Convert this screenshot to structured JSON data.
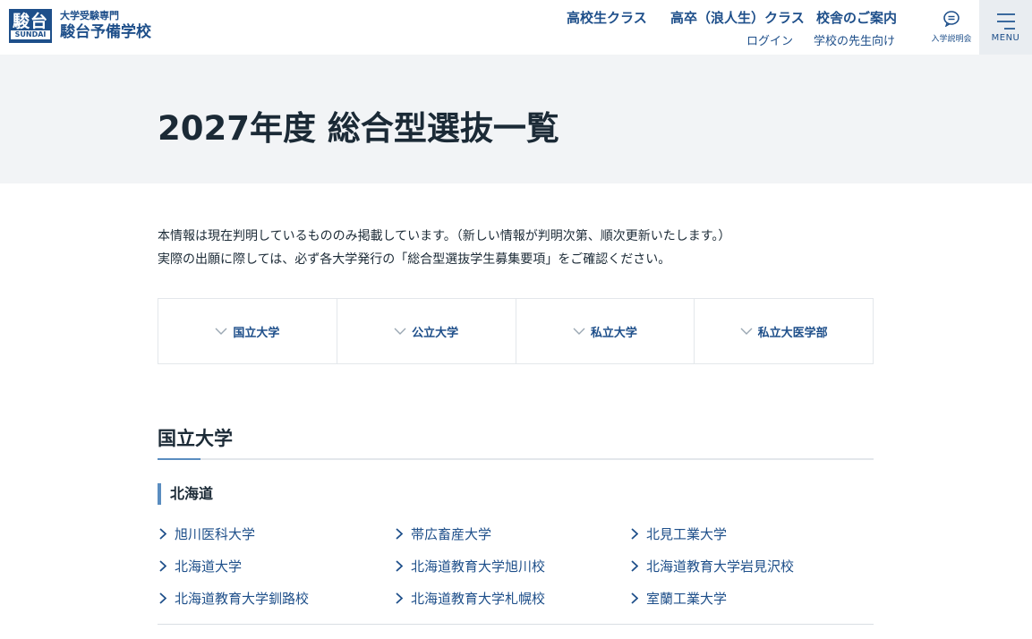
{
  "header": {
    "logo": {
      "mark_top": "駿台",
      "mark_bottom": "SUNDAI",
      "tagline": "大学受験専門",
      "name": "駿台予備学校"
    },
    "nav_main": [
      "高校生クラス",
      "高卒（浪人生）クラス",
      "校舎のご案内"
    ],
    "nav_sub": [
      "ログイン",
      "学校の先生向け"
    ],
    "seminar_label": "入学説明会",
    "menu_label": "MENU",
    "icons": {
      "seminar": "chat-bubble-icon",
      "menu": "hamburger-icon"
    }
  },
  "page": {
    "title": "2027年度 総合型選抜一覧",
    "intro": [
      "本情報は現在判明しているもののみ掲載しています。（新しい情報が判明次第、順次更新いたします。）",
      "実際の出願に際しては、必ず各大学発行の「総合型選抜学生募集要項」をご確認ください。"
    ]
  },
  "tabs": [
    "国立大学",
    "公立大学",
    "私立大学",
    "私立大医学部"
  ],
  "section": {
    "title": "国立大学",
    "region": "北海道",
    "universities": [
      "旭川医科大学",
      "帯広畜産大学",
      "北見工業大学",
      "北海道大学",
      "北海道教育大学旭川校",
      "北海道教育大学岩見沢校",
      "北海道教育大学釧路校",
      "北海道教育大学札幌校",
      "室蘭工業大学"
    ]
  },
  "colors": {
    "brand": "#1e4f8a",
    "accent": "#5a8dc0",
    "band": "#f2f4f6",
    "text": "#1b2a36"
  }
}
